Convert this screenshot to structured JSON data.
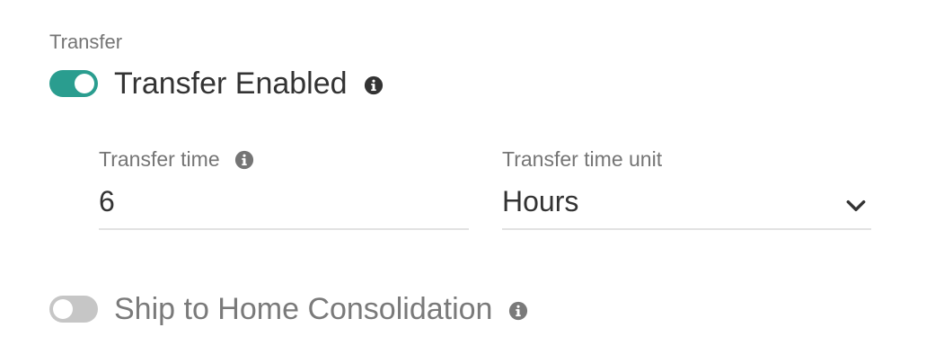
{
  "section": {
    "label": "Transfer"
  },
  "transfer_toggle": {
    "label": "Transfer Enabled",
    "enabled": true,
    "icon": "info-icon"
  },
  "transfer_time": {
    "label": "Transfer time",
    "value": "6",
    "icon": "info-icon"
  },
  "transfer_time_unit": {
    "label": "Transfer time unit",
    "value": "Hours",
    "icon": "chevron-down-icon"
  },
  "ship_to_home_toggle": {
    "label": "Ship to Home Consolidation",
    "enabled": false,
    "icon": "info-icon"
  },
  "colors": {
    "accent": "#2a9d8f",
    "toggle_off": "#c6c6c6",
    "text_primary": "#333333",
    "text_secondary": "#757575",
    "underline": "#e2e2e2"
  }
}
